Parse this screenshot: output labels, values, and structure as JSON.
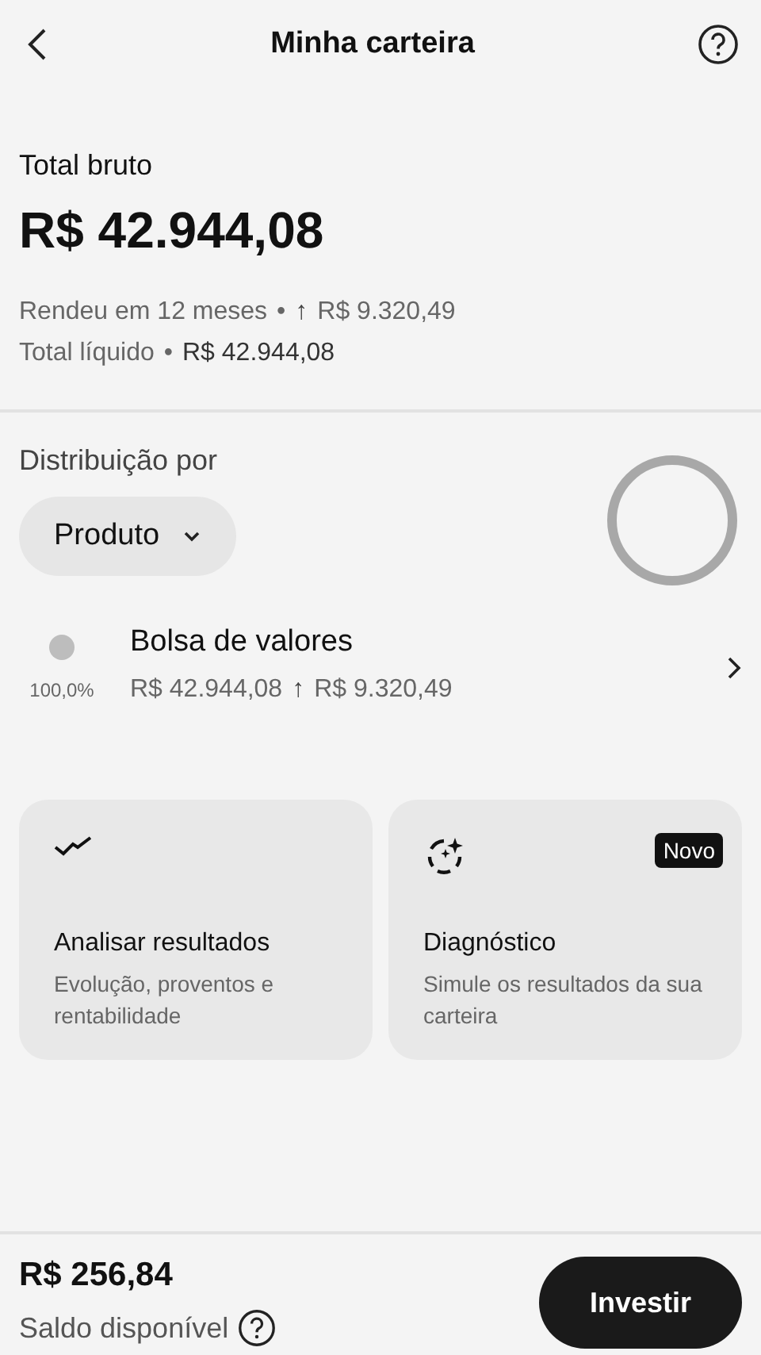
{
  "header": {
    "title": "Minha carteira"
  },
  "summary": {
    "label": "Total bruto",
    "amount": "R$ 42.944,08",
    "yield_label": "Rendeu em 12 meses",
    "separator": "•",
    "yield_arrow": "↑",
    "yield_value": "R$ 9.320,49",
    "net_label": "Total líquido",
    "net_separator": "•",
    "net_value": "R$ 42.944,08"
  },
  "distribution": {
    "label": "Distribuição por",
    "selector": "Produto",
    "items": [
      {
        "name": "Bolsa de valores",
        "percent": "100,0%",
        "value": "R$ 42.944,08",
        "arrow": "↑",
        "gain": "R$ 9.320,49"
      }
    ]
  },
  "cards": [
    {
      "kind": "analysis",
      "title": "Analisar resultados",
      "text": "Evolução, proventos e rentabilidade"
    },
    {
      "kind": "diagnostic",
      "title": "Diagnóstico",
      "text": "Simule os resultados da sua carteira",
      "badge": "Novo"
    }
  ],
  "footer": {
    "balance": "R$ 256,84",
    "balance_label": "Saldo disponível",
    "button": "Investir"
  }
}
